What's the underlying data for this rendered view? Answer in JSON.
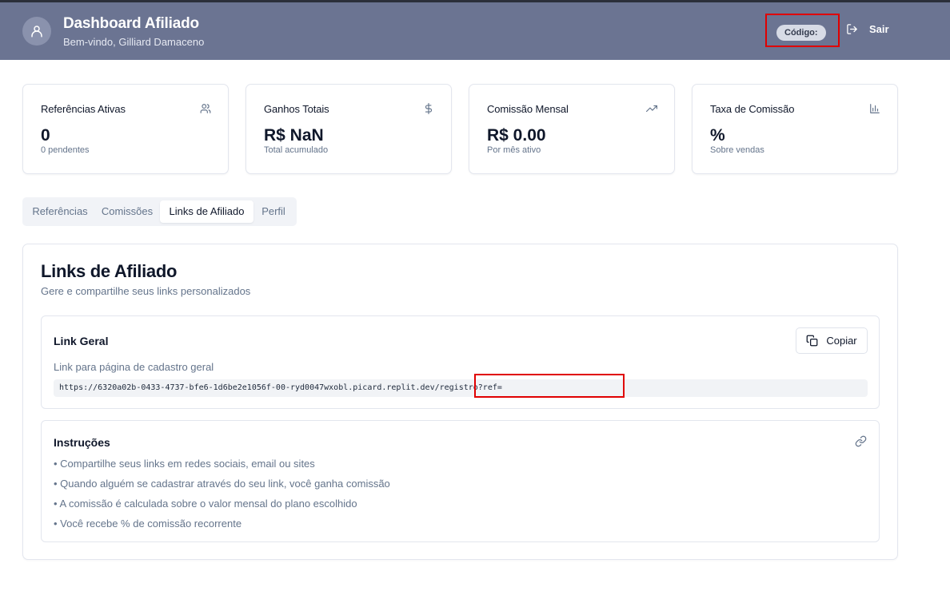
{
  "header": {
    "title": "Dashboard Afiliado",
    "subtitle": "Bem-vindo, Gilliard Damaceno",
    "code_label": "Código:",
    "logout_label": "Sair",
    "avatar_icon": "user-icon",
    "logout_icon": "log-out-icon"
  },
  "stats": [
    {
      "label": "Referências Ativas",
      "value": "0",
      "note": "0 pendentes",
      "icon": "users-icon"
    },
    {
      "label": "Ganhos Totais",
      "value": "R$ NaN",
      "note": "Total acumulado",
      "icon": "dollar-icon"
    },
    {
      "label": "Comissão Mensal",
      "value": "R$ 0.00",
      "note": "Por mês ativo",
      "icon": "trending-up-icon"
    },
    {
      "label": "Taxa de Comissão",
      "value": "%",
      "note": "Sobre vendas",
      "icon": "bar-chart-icon"
    }
  ],
  "tabs": [
    {
      "label": "Referências",
      "active": false
    },
    {
      "label": "Comissões",
      "active": false
    },
    {
      "label": "Links de Afiliado",
      "active": true
    },
    {
      "label": "Perfil",
      "active": false
    }
  ],
  "links": {
    "title": "Links de Afiliado",
    "subtitle": "Gere e compartilhe seus links personalizados",
    "general": {
      "title": "Link Geral",
      "copy_label": "Copiar",
      "copy_icon": "copy-icon",
      "description": "Link para página de cadastro geral",
      "url": "https://6320a02b-0433-4737-bfe6-1d6be2e1056f-00-ryd0047wxobl.picard.replit.dev/registro?ref="
    },
    "instructions": {
      "title": "Instruções",
      "icon": "link-icon",
      "items": [
        "• Compartilhe seus links em redes sociais, email ou sites",
        "• Quando alguém se cadastrar através do seu link, você ganha comissão",
        "• A comissão é calculada sobre o valor mensal do plano escolhido",
        "• Você recebe % de comissão recorrente"
      ]
    }
  },
  "colors": {
    "header_bg": "#6b7492",
    "highlight": "#e00000"
  }
}
